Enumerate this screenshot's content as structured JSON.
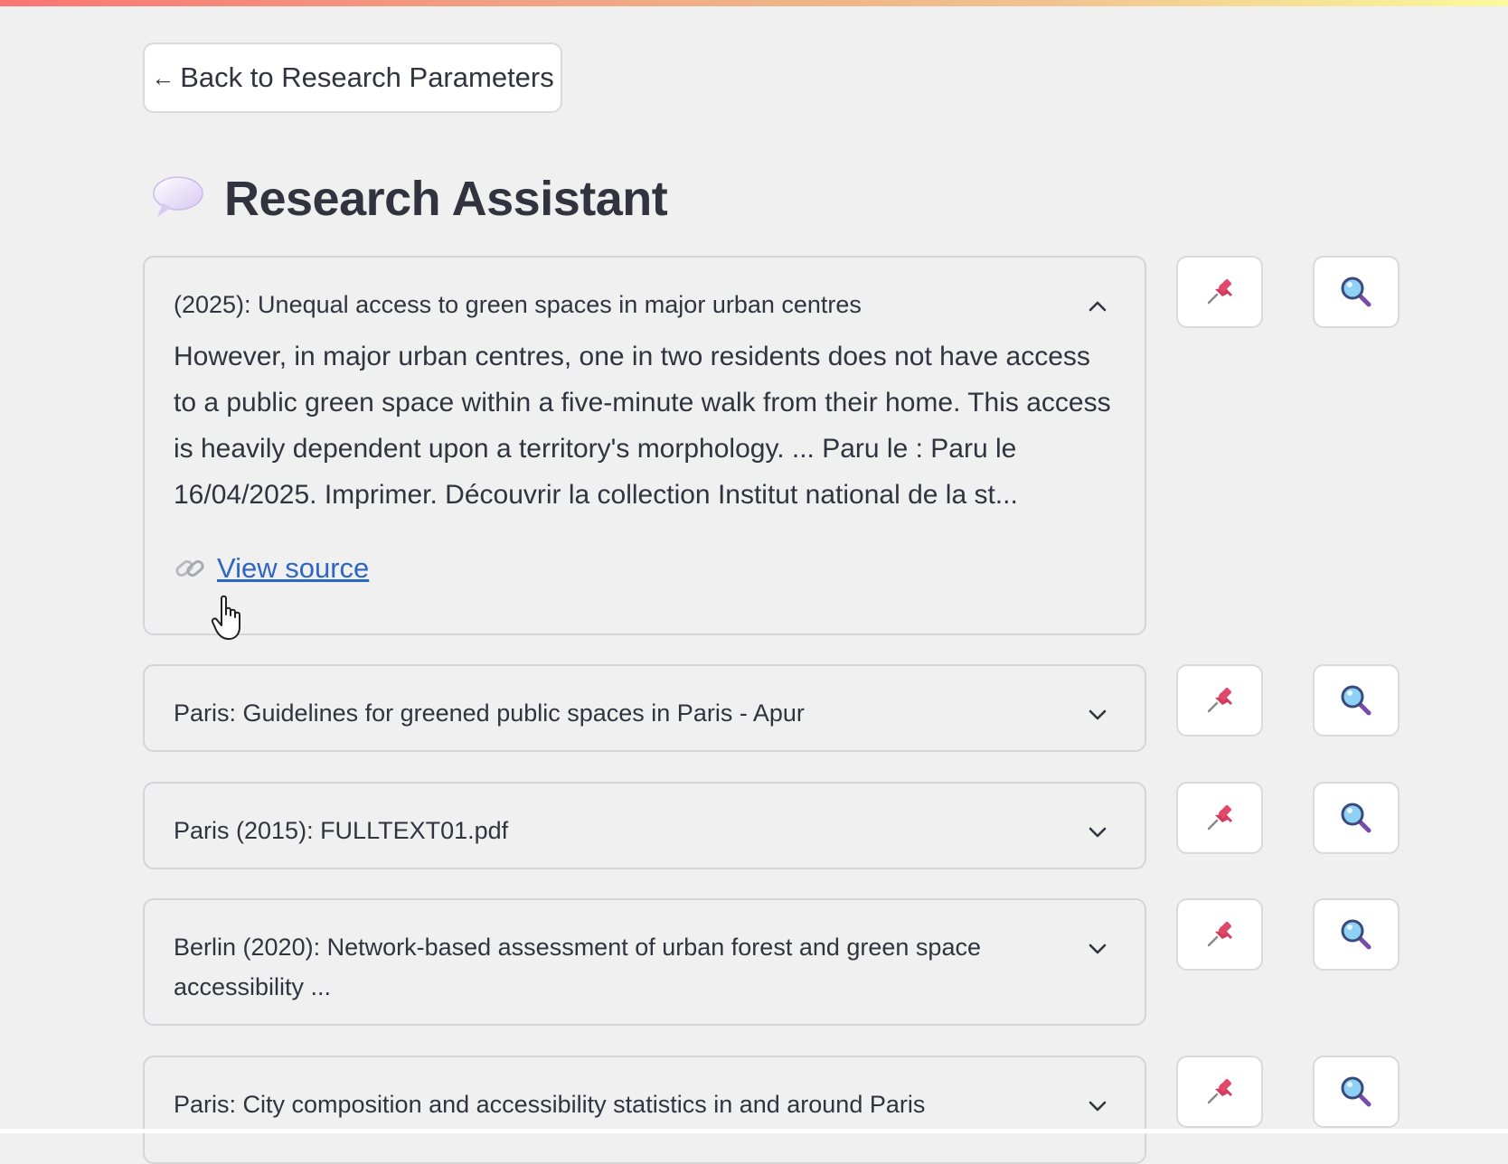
{
  "back_button": {
    "label": "Back to Research Parameters",
    "arrow": "←"
  },
  "header": {
    "title": "Research Assistant",
    "icon": "speech-bubble-icon"
  },
  "results": [
    {
      "title": "(2025): Unequal access to green spaces in major urban centres",
      "expanded": true,
      "snippet": "However, in major urban centres, one in two residents does not have access to a public green space within a five-minute walk from their home. This access is heavily dependent upon a territory's morphology. ... Paru le : Paru le 16/04/2025. Imprimer. Découvrir la collection Institut national de la st...",
      "link_label": "View source"
    },
    {
      "title": "Paris: Guidelines for greened public spaces in Paris - Apur",
      "expanded": false
    },
    {
      "title": "Paris (2015): FULLTEXT01.pdf",
      "expanded": false
    },
    {
      "title": "Berlin (2020): Network-based assessment of urban forest and green space accessibility ...",
      "expanded": false
    },
    {
      "title": "Paris: City composition and accessibility statistics in and around Paris",
      "expanded": false
    }
  ],
  "actions": {
    "pin_icon": "pushpin-icon",
    "search_icon": "magnifier-icon"
  },
  "colors": {
    "link": "#2e66c4",
    "pin": "#d43c5e",
    "magnifier": "#5aa7de"
  }
}
